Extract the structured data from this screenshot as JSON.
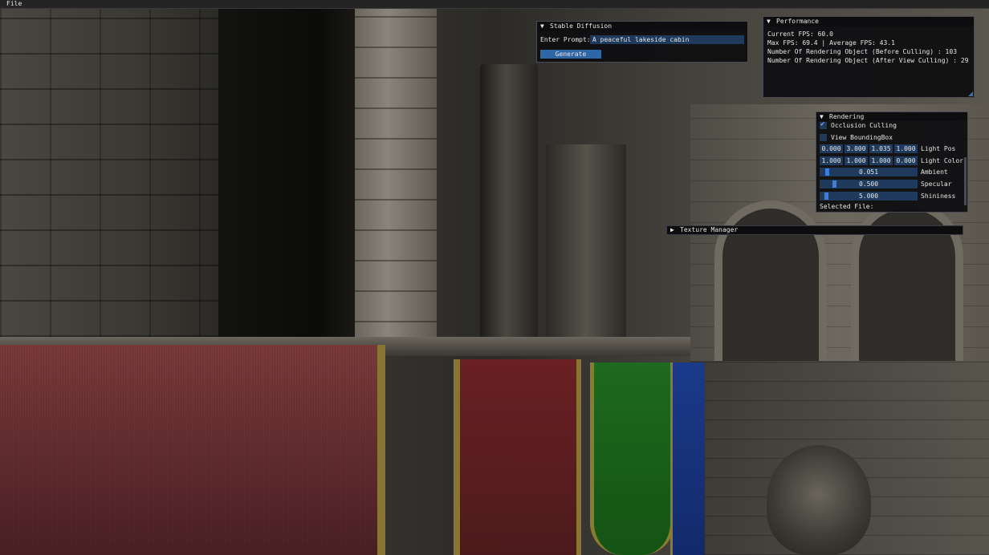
{
  "menubar": {
    "file_label": "File"
  },
  "stable_diffusion": {
    "title": "Stable Diffusion",
    "prompt_label": "Enter Prompt:",
    "prompt_value": "A peaceful lakeside cabin",
    "generate_label": "Generate"
  },
  "performance": {
    "title": "Performance",
    "lines": [
      "Current FPS: 60.0",
      "Max FPS: 69.4 | Average FPS: 43.1",
      "Number Of Rendering Object (Before Culling) : 103",
      "Number Of Rendering Object (After View Culling) : 29"
    ]
  },
  "rendering": {
    "title": "Rendering",
    "occlusion_culling_label": "Occlusion Culling",
    "occlusion_culling_checked": true,
    "view_bbox_label": "View BoundingBox",
    "view_bbox_checked": false,
    "light_pos": {
      "label": "Light Pos",
      "values": [
        "0.000",
        "3.000",
        "1.035",
        "1.000"
      ]
    },
    "light_color": {
      "label": "Light Color",
      "values": [
        "1.000",
        "1.000",
        "1.000",
        "0.000"
      ]
    },
    "ambient": {
      "label": "Ambient",
      "value": "0.051",
      "fraction": 0.051
    },
    "specular": {
      "label": "Specular",
      "value": "0.500",
      "fraction": 0.125
    },
    "shininess": {
      "label": "Shininess",
      "value": "5.000",
      "fraction": 0.04
    },
    "selected_file_label": "Selected File:"
  },
  "texture_manager": {
    "title": "Texture Manager"
  },
  "colors": {
    "frame_bg": "#1f3a5c",
    "accent": "#3c7ee0",
    "button": "#2f67a6"
  }
}
